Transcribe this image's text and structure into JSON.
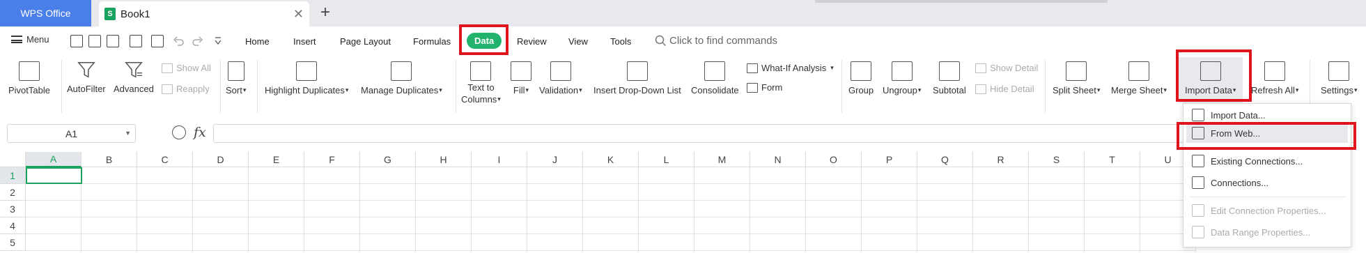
{
  "titlebar": {
    "app_tab": "WPS Office",
    "doc_tab": "Book1",
    "doc_icon_letter": "S",
    "close_glyph": "✕",
    "new_tab_glyph": "+"
  },
  "menubar": {
    "menu_label": "Menu",
    "tabs": [
      "Home",
      "Insert",
      "Page Layout",
      "Formulas",
      "Data",
      "Review",
      "View",
      "Tools"
    ],
    "active_tab": "Data",
    "search_placeholder": "Click to find commands"
  },
  "ribbon": {
    "pivot_table": "PivotTable",
    "autofilter": "AutoFilter",
    "advanced": "Advanced",
    "show_all": "Show All",
    "reapply": "Reapply",
    "sort": "Sort",
    "highlight_duplicates": "Highlight Duplicates",
    "manage_duplicates": "Manage Duplicates",
    "text_to_columns_1": "Text to",
    "text_to_columns_2": "Columns",
    "fill": "Fill",
    "validation": "Validation",
    "insert_dropdown_list": "Insert Drop-Down List",
    "consolidate": "Consolidate",
    "what_if": "What-If Analysis",
    "form": "Form",
    "group": "Group",
    "ungroup": "Ungroup",
    "subtotal": "Subtotal",
    "show_detail": "Show Detail",
    "hide_detail": "Hide Detail",
    "split_sheet": "Split Sheet",
    "merge_sheet": "Merge Sheet",
    "import_data": "Import Data",
    "refresh_all": "Refresh All",
    "settings": "Settings"
  },
  "formula_bar": {
    "name_box": "A1",
    "fx_label": "fx",
    "formula": ""
  },
  "grid": {
    "columns": [
      "A",
      "B",
      "C",
      "D",
      "E",
      "F",
      "G",
      "H",
      "I",
      "J",
      "K",
      "L",
      "M",
      "N",
      "O",
      "P",
      "Q",
      "R",
      "S",
      "T",
      "U"
    ],
    "rows": [
      "1",
      "2",
      "3",
      "4",
      "5"
    ],
    "active_cell": "A1"
  },
  "import_menu": {
    "import_data": "Import Data...",
    "from_web": "From Web...",
    "existing_connections": "Existing Connections...",
    "connections": "Connections...",
    "edit_connection_properties": "Edit Connection Properties...",
    "data_range_properties": "Data Range Properties..."
  },
  "colors": {
    "accent_green": "#1aa260",
    "wps_blue": "#4a7ee8",
    "highlight_red": "#e0141d"
  }
}
